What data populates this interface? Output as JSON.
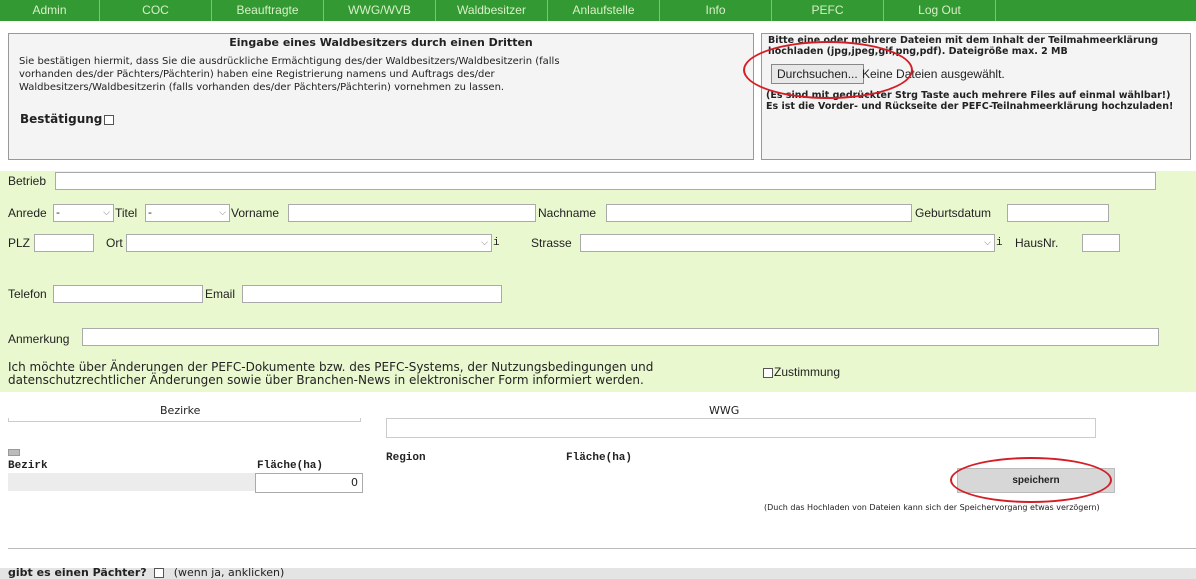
{
  "nav": {
    "items": [
      "Admin",
      "COC",
      "Beauftragte",
      "WWG/WVB",
      "Waldbesitzer",
      "Anlaufstelle",
      "Info",
      "PEFC",
      "Log Out"
    ]
  },
  "consent_box": {
    "title": "Eingabe eines Waldbesitzers durch einen Dritten",
    "text": "Sie bestätigen hiermit, dass Sie die ausdrückliche Ermächtigung des/der Waldbesitzers/Waldbesitzerin (falls vorhanden des/der Pächters/Pächterin) haben eine Registrierung namens und Auftrags des/der Waldbesitzers/Waldbesitzerin (falls vorhanden des/der Pächters/Pächterin) vornehmen zu lassen.",
    "label": "Bestätigung"
  },
  "upload_box": {
    "instruction": "Bitte eine oder mehrere Dateien mit dem Inhalt der Teilmahmeerklärung hochladen (jpg,jpeg,gif,png,pdf). Dateigröße max. 2 MB",
    "browse_label": "Durchsuchen...",
    "no_file_label": "Keine Dateien ausgewählt.",
    "hint1": "(Es sind mit gedrückter Strg Taste auch mehrere Files auf einmal wählbar!)",
    "hint2": "Es ist die Vorder- und Rückseite der PEFC-Teilnahmeerklärung hochzuladen!"
  },
  "form": {
    "betrieb_label": "Betrieb",
    "anrede_label": "Anrede",
    "anrede_value": "-",
    "titel_label": "Titel",
    "titel_value": "-",
    "vorname_label": "Vorname",
    "nachname_label": "Nachname",
    "geburtsdatum_label": "Geburtsdatum",
    "plz_label": "PLZ",
    "ort_label": "Ort",
    "strasse_label": "Strasse",
    "hausnr_label": "HausNr.",
    "info_glyph": "i",
    "telefon_label": "Telefon",
    "email_label": "Email",
    "anmerkung_label": "Anmerkung",
    "newsletter_text": "Ich möchte über Änderungen der PEFC-Dokumente bzw. des PEFC-Systems, der Nutzungsbedingungen und datenschutzrechtlicher Änderungen sowie über Branchen-News in elektronischer Form informiert werden.",
    "zustimmung_label": "Zustimmung"
  },
  "bezirke": {
    "heading": "Bezirke",
    "col_bezirk": "Bezirk",
    "col_flaeche": "Fläche(ha)",
    "flaeche_value": "0"
  },
  "wwg": {
    "heading": "WWG",
    "col_region": "Region",
    "col_flaeche": "Fläche(ha)"
  },
  "save": {
    "label": "speichern",
    "note": "(Duch das Hochladen von Dateien kann sich der Speichervorgang etwas verzögern)"
  },
  "paechter": {
    "question": "gibt es einen Pächter?",
    "hint": "(wenn ja, anklicken)"
  },
  "colors": {
    "nav_green": "#339933",
    "form_green": "#eaf8d0",
    "highlight_red": "#d41e26"
  }
}
